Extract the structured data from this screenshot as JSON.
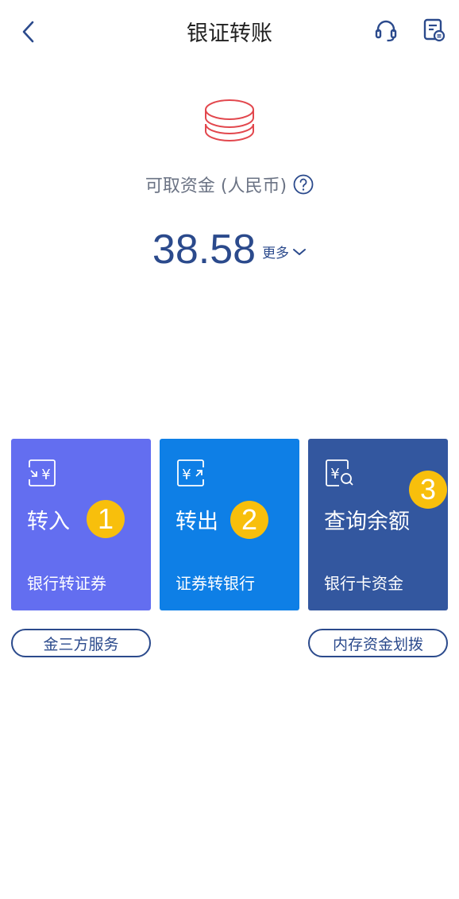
{
  "header": {
    "title": "银证转账",
    "back_icon": "chevron-left-icon",
    "service_icon": "headset-icon",
    "records_icon": "document-icon"
  },
  "balance": {
    "label": "可取资金 (人民币)",
    "amount": "38.58",
    "more_label": "更多"
  },
  "cards": [
    {
      "title": "转入",
      "subtitle": "银行转证券",
      "icon": "transfer-in-icon",
      "badge": "1",
      "color": "#636ef0"
    },
    {
      "title": "转出",
      "subtitle": "证券转银行",
      "icon": "transfer-out-icon",
      "badge": "2",
      "color": "#0e7fe6"
    },
    {
      "title": "查询余额",
      "subtitle": "银行卡资金",
      "icon": "balance-search-icon",
      "badge": "3",
      "color": "#33579f"
    }
  ],
  "links": {
    "left": "金三方服务",
    "right": "内存资金划拨"
  },
  "colors": {
    "accent": "#2b4a8c",
    "coin": "#e2474d",
    "badge": "#f8bf0c"
  }
}
